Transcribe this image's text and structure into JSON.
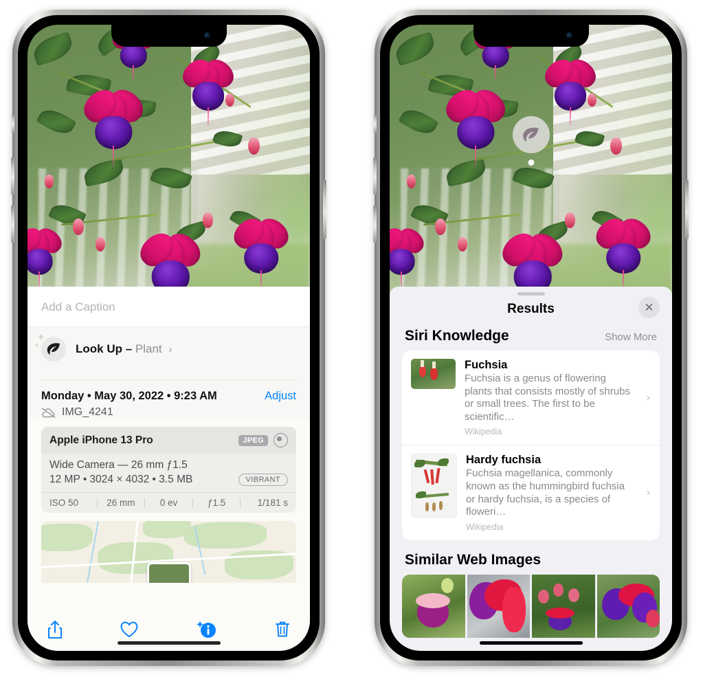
{
  "left_phone": {
    "caption_placeholder": "Add a Caption",
    "lookup": {
      "label": "Look Up –",
      "subject": "Plant",
      "chevron": "›",
      "icon": "leaf-icon"
    },
    "date_line": "Monday • May 30, 2022 • 9:23 AM",
    "adjust_label": "Adjust",
    "filename": "IMG_4241",
    "cloud_icon": "cloud-slash-icon",
    "exif": {
      "device": "Apple iPhone 13 Pro",
      "format_badge": "JPEG",
      "raw_icon": "raw-circle-icon",
      "lens_line": "Wide Camera — 26 mm ƒ1.5",
      "size_line": "12 MP • 3024 × 4032 • 3.5 MB",
      "style_badge": "VIBRANT",
      "stats": [
        "ISO 50",
        "26 mm",
        "0 ev",
        "ƒ1.5",
        "1/181 s"
      ]
    },
    "toolbar": [
      {
        "name": "share-button",
        "icon": "share-icon"
      },
      {
        "name": "favorite-button",
        "icon": "heart-icon"
      },
      {
        "name": "info-button",
        "icon": "info-sparkle-icon"
      },
      {
        "name": "delete-button",
        "icon": "trash-icon"
      }
    ]
  },
  "right_phone": {
    "lookup_badge_icon": "leaf-icon",
    "panel": {
      "title": "Results",
      "close_icon": "close-icon",
      "siri_section": {
        "title": "Siri Knowledge",
        "show_more": "Show More",
        "cards": [
          {
            "title": "Fuchsia",
            "description": "Fuchsia is a genus of flowering plants that consists mostly of shrubs or small trees. The first to be scientific…",
            "source": "Wikipedia",
            "chevron": "›"
          },
          {
            "title": "Hardy fuchsia",
            "description": "Fuchsia magellanica, commonly known as the hummingbird fuchsia or hardy fuchsia, is a species of floweri…",
            "source": "Wikipedia",
            "chevron": "›"
          }
        ]
      },
      "similar_section": {
        "title": "Similar Web Images",
        "thumbnails": [
          "web-image-1",
          "web-image-2",
          "web-image-3",
          "web-image-4"
        ]
      }
    }
  },
  "colors": {
    "accent_blue": "#0a84ff",
    "panel_bg": "#f1f0f5",
    "sheet_bg": "#fbfbf8",
    "secondary_text": "#8e8e93"
  }
}
